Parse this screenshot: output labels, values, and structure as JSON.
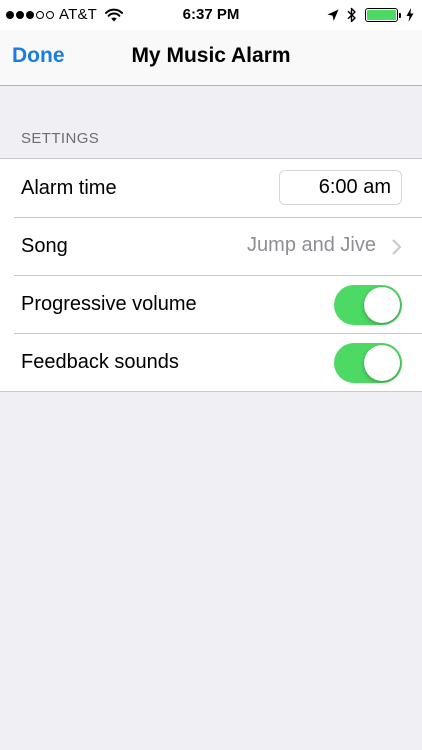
{
  "status_bar": {
    "signal_bars": 3,
    "signal_total": 5,
    "carrier": "AT&T",
    "time": "6:37 PM",
    "icons": [
      "wifi-icon",
      "location-arrow-icon",
      "bluetooth-icon",
      "battery-icon",
      "charging-bolt-icon"
    ],
    "battery_level": 1.0,
    "battery_color": "#4cd964"
  },
  "nav": {
    "done_label": "Done",
    "title": "My Music Alarm",
    "accent_color": "#1a7ce4"
  },
  "settings": {
    "header": "SETTINGS",
    "alarm_time": {
      "label": "Alarm time",
      "value": "6:00 am"
    },
    "song": {
      "label": "Song",
      "value": "Jump and Jive"
    },
    "progressive_volume": {
      "label": "Progressive volume",
      "on": true
    },
    "feedback_sounds": {
      "label": "Feedback sounds",
      "on": true
    },
    "toggle_on_color": "#4cd964"
  }
}
